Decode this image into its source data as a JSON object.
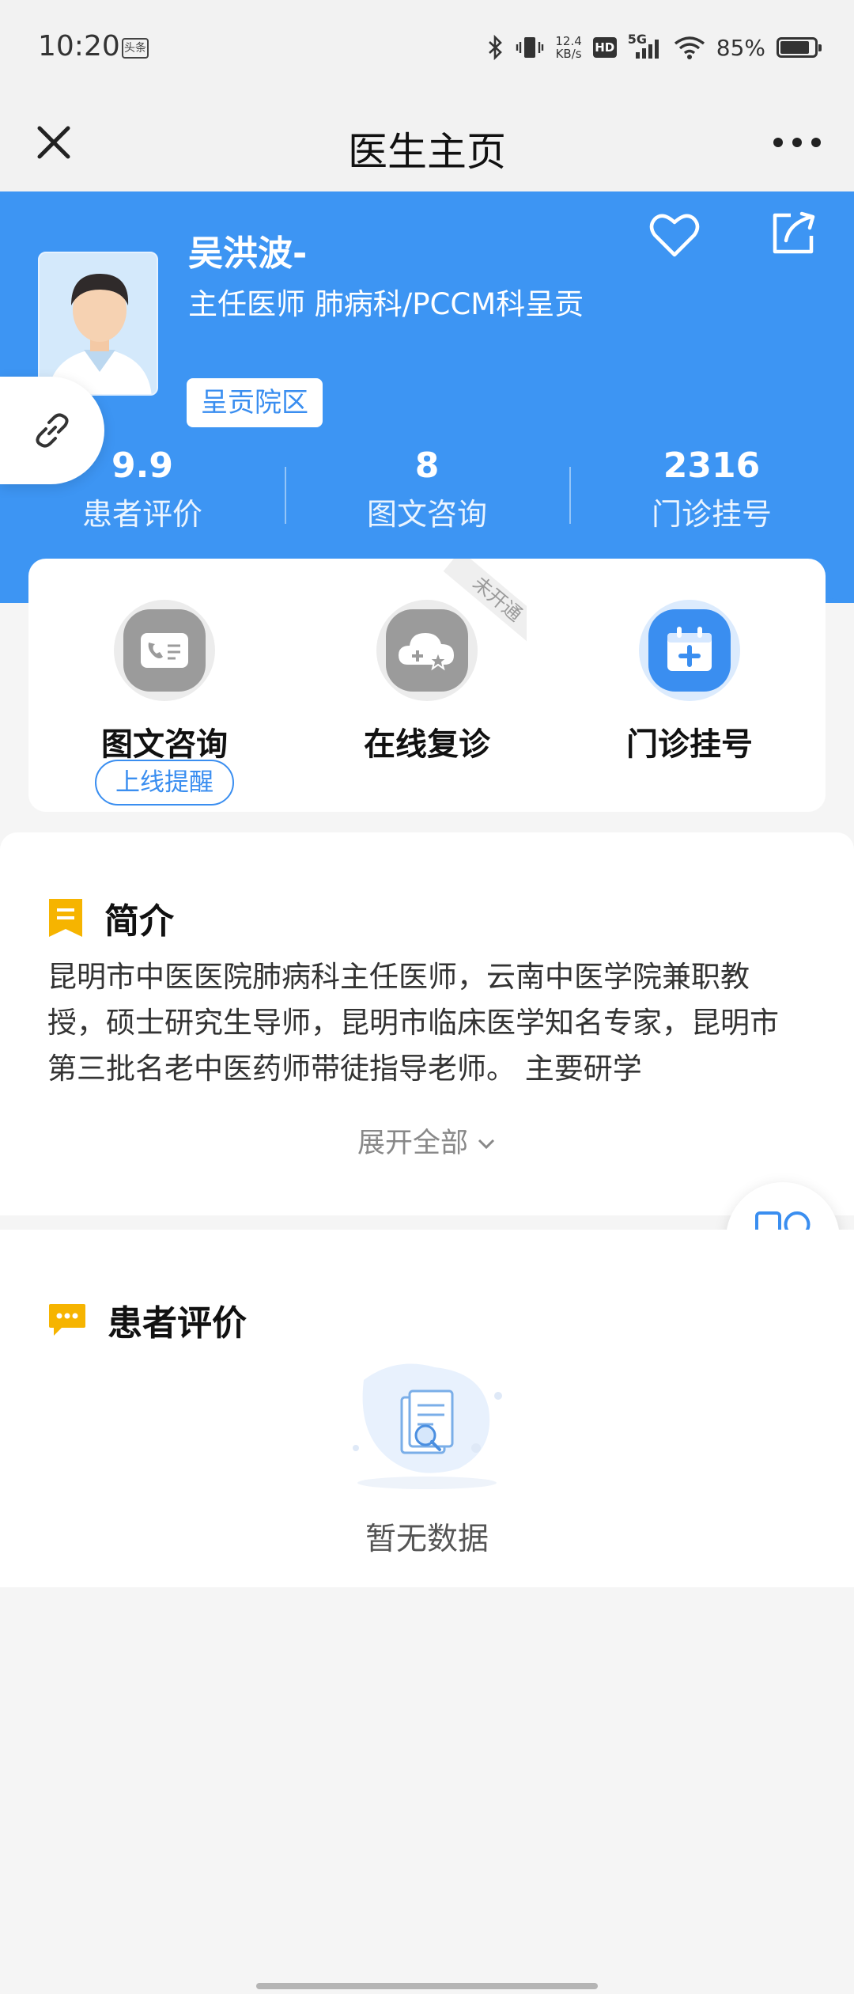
{
  "status_bar": {
    "time": "10:20",
    "app_badge": "头条",
    "net_speed_value": "12.4",
    "net_speed_unit": "KB/s",
    "hd": "HD",
    "network": "5G",
    "battery_percent": "85%",
    "battery_level": 0.85
  },
  "nav": {
    "title": "医生主页"
  },
  "doctor": {
    "name": "吴洪波-",
    "title": "主任医师  肺病科/PCCM科呈贡",
    "hospital": "呈贡院区"
  },
  "stats": [
    {
      "value": "9.9",
      "label": "患者评价"
    },
    {
      "value": "8",
      "label": "图文咨询"
    },
    {
      "value": "2316",
      "label": "门诊挂号"
    }
  ],
  "services": {
    "items": [
      {
        "label": "图文咨询",
        "icon": "phone-card-icon"
      },
      {
        "label": "在线复诊",
        "icon": "cloud-plus-icon"
      },
      {
        "label": "门诊挂号",
        "icon": "calendar-plus-icon"
      }
    ],
    "remind_label": "上线提醒",
    "not_open_ribbon": "未开通"
  },
  "intro": {
    "heading": "简介",
    "text": "昆明市中医医院肺病科主任医师，云南中医学院兼职教授，硕士研究生导师，昆明市临床医学知名专家，昆明市第三批名老中医药师带徒指导老师。 主要研学",
    "expand_label": "展开全部"
  },
  "reviews": {
    "heading": "患者评价",
    "empty_text": "暂无数据"
  },
  "colors": {
    "brand": "#3d95f3",
    "accent_yellow": "#f6b400",
    "text_dark": "#111111"
  }
}
